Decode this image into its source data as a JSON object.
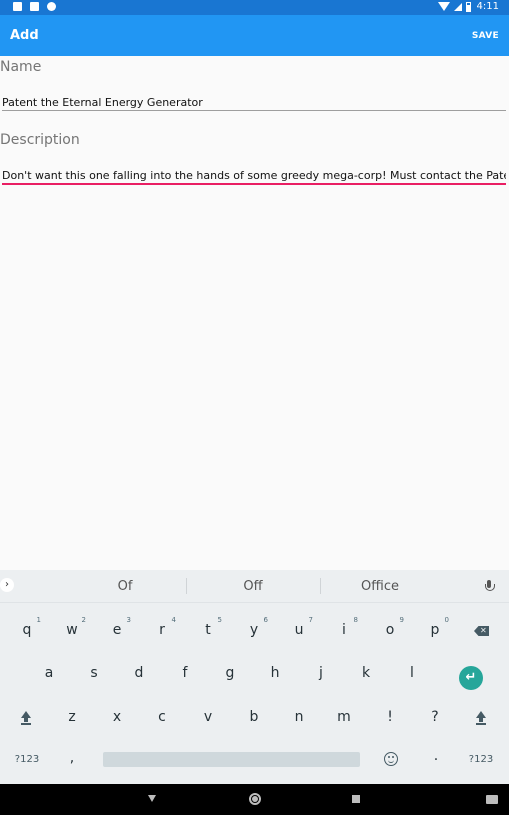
{
  "status_bar": {
    "time": "4:11",
    "icons": [
      "notification-a-icon",
      "sd-card-icon",
      "sync-icon",
      "wifi-icon",
      "cell-signal-icon",
      "battery-icon"
    ]
  },
  "app_bar": {
    "title": "Add",
    "save_label": "SAVE",
    "background": "#2196f3"
  },
  "form": {
    "name": {
      "label": "Name",
      "value": "Patent the Eternal Energy Generator"
    },
    "description": {
      "label": "Description",
      "value": "Don't want this one falling into the hands of some greedy mega-corp! Must contact the Patent Of",
      "underline_color": "#e91e63"
    }
  },
  "keyboard": {
    "suggestions": [
      "Of",
      "Off",
      "Office"
    ],
    "row1": [
      {
        "key": "q",
        "hint": "1"
      },
      {
        "key": "w",
        "hint": "2"
      },
      {
        "key": "e",
        "hint": "3"
      },
      {
        "key": "r",
        "hint": "4"
      },
      {
        "key": "t",
        "hint": "5"
      },
      {
        "key": "y",
        "hint": "6"
      },
      {
        "key": "u",
        "hint": "7"
      },
      {
        "key": "i",
        "hint": "8"
      },
      {
        "key": "o",
        "hint": "9"
      },
      {
        "key": "p",
        "hint": "0"
      }
    ],
    "row2": [
      "a",
      "s",
      "d",
      "f",
      "g",
      "h",
      "j",
      "k",
      "l"
    ],
    "row3": [
      "z",
      "x",
      "c",
      "v",
      "b",
      "n",
      "m",
      "!",
      "?"
    ],
    "bottom": {
      "symbols_left": "?123",
      "comma": ",",
      "period": "·",
      "symbols_right": "?123"
    },
    "accent_color": "#26a69a"
  },
  "nav_bar": {
    "icons": [
      "back-icon",
      "home-icon",
      "recents-icon",
      "keyboard-switch-icon"
    ]
  }
}
